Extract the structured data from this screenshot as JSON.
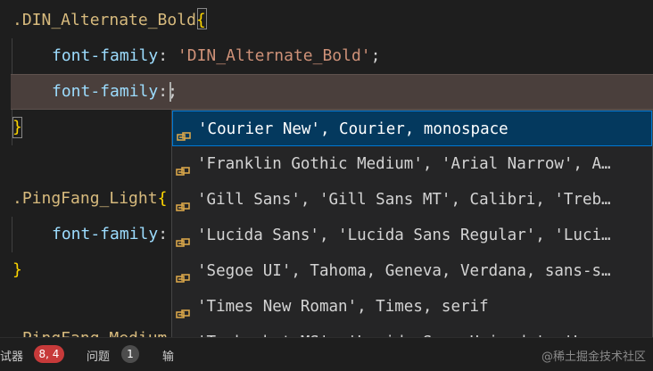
{
  "editor": {
    "line1": {
      "selector": ".DIN_Alternate_Bold",
      "brace": "{"
    },
    "line2": {
      "property": "font-family",
      "colon": ":",
      "value": "'DIN_Alternate_Bold'",
      "semi": ";"
    },
    "line3": {
      "property": "font-family",
      "colon": ":",
      "semi": ";"
    },
    "line4": {
      "brace": "}"
    },
    "line6": {
      "selector": ".PingFang_Light",
      "brace": "{"
    },
    "line7": {
      "property": "font-family",
      "colon": ":"
    },
    "line8": {
      "brace": "}"
    },
    "line10": {
      "selector": ".PingFang_Medium"
    }
  },
  "suggestions": {
    "icon": "property-value-icon",
    "items": [
      "'Courier New', Courier, monospace",
      "'Franklin Gothic Medium', 'Arial Narrow', A…",
      "'Gill Sans', 'Gill Sans MT', Calibri, 'Treb…",
      "'Lucida Sans', 'Lucida Sans Regular', 'Luci…",
      "'Segoe UI', Tahoma, Geneva, Verdana, sans-s…",
      "'Times New Roman', Times, serif",
      "'Trebuchet MS', 'Lucida Sans Unicode', 'Luc…"
    ],
    "active_index": 0
  },
  "statusbar": {
    "debug_label": "试器",
    "debug_count": "8, 4",
    "problems_label": "问题",
    "problems_count": "1",
    "output_label": "输"
  },
  "watermark": "@稀土掘金技术社区",
  "colors": {
    "accent": "#0078d4",
    "active_item_bg": "#04395e",
    "badge_red": "#c73a3a"
  }
}
